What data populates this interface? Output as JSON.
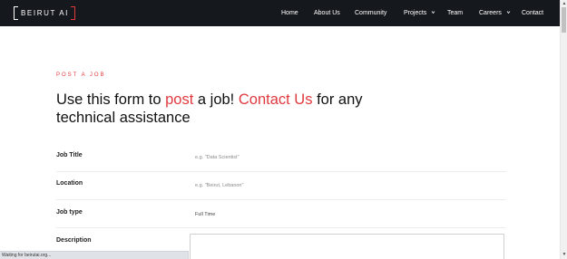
{
  "logo": {
    "word": "BEIRUT",
    "ai": "AI"
  },
  "nav": [
    {
      "label": "Home"
    },
    {
      "label": "About Us"
    },
    {
      "label": "Community"
    },
    {
      "label": "Projects"
    },
    {
      "label": "Team"
    },
    {
      "label": "Careers"
    },
    {
      "label": "Contact"
    }
  ],
  "page": {
    "eyebrow": "POST A JOB",
    "headline": {
      "part1": "Use this form to ",
      "accent1": "post",
      "part2": " a job! ",
      "accent2": "Contact Us",
      "part3": " for any technical assistance"
    }
  },
  "form": {
    "job_title": {
      "label": "Job Title",
      "placeholder": "e.g. \"Data Scientist\""
    },
    "location": {
      "label": "Location",
      "placeholder": "e.g. \"Beirut, Lebanon\""
    },
    "job_type": {
      "label": "Job type",
      "value": "Full Time"
    },
    "description": {
      "label": "Description"
    }
  },
  "status_bar": {
    "text": "Waiting for beirutai.org..."
  },
  "colors": {
    "accent": "#e0393e",
    "navbar": "#15191e"
  }
}
